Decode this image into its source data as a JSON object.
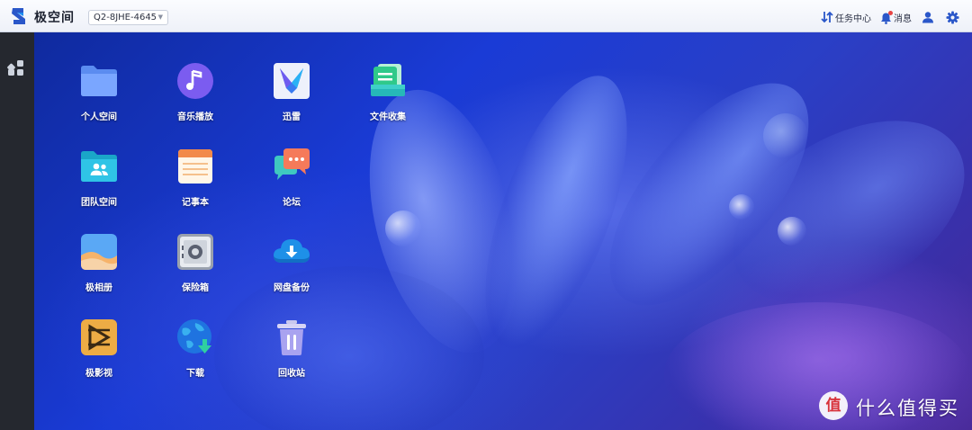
{
  "topbar": {
    "brand": "极空间",
    "device": "Q2-8JHE-4645",
    "task_center": "任务中心",
    "messages": "消息"
  },
  "apps": [
    {
      "label": "个人空间",
      "icon": "folder-icon"
    },
    {
      "label": "音乐播放",
      "icon": "music-icon"
    },
    {
      "label": "迅雷",
      "icon": "thunder-bird-icon"
    },
    {
      "label": "文件收集",
      "icon": "file-collect-icon"
    },
    {
      "label": "团队空间",
      "icon": "team-folder-icon"
    },
    {
      "label": "记事本",
      "icon": "notepad-icon"
    },
    {
      "label": "论坛",
      "icon": "forum-chat-icon"
    },
    {
      "label": "极相册",
      "icon": "photo-album-icon"
    },
    {
      "label": "保险箱",
      "icon": "safe-box-icon"
    },
    {
      "label": "网盘备份",
      "icon": "cloud-backup-icon"
    },
    {
      "label": "极影视",
      "icon": "video-icon"
    },
    {
      "label": "下载",
      "icon": "download-globe-icon"
    },
    {
      "label": "回收站",
      "icon": "trash-icon"
    }
  ],
  "watermark": {
    "badge": "值",
    "text": "什么值得买"
  },
  "colors": {
    "topbar_bg": "#f2f4fa",
    "dock_bg": "#25282f",
    "accent": "#2a57c9"
  }
}
